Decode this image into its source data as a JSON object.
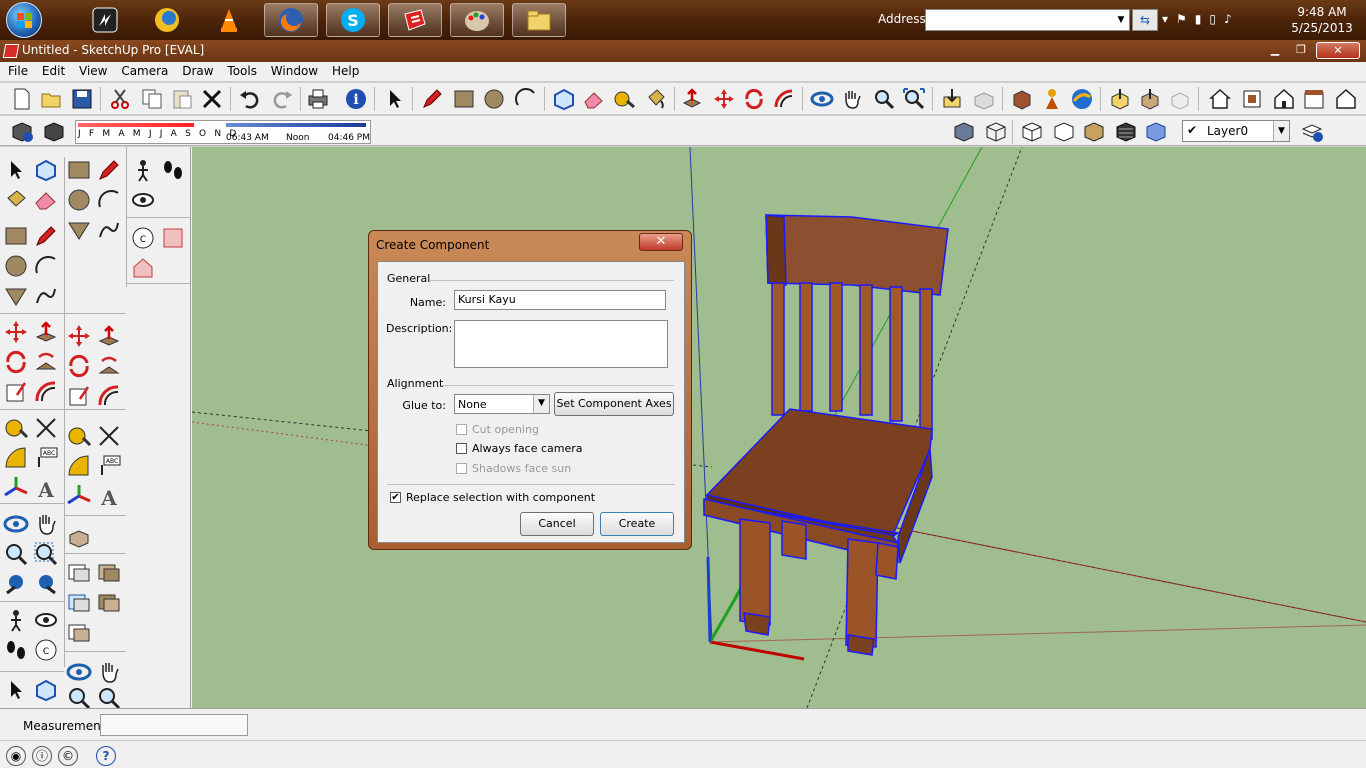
{
  "taskbar": {
    "address_label": "Address",
    "address_value": "",
    "clock_time": "9:48 AM",
    "clock_date": "5/25/2013"
  },
  "window": {
    "title": "Untitled - SketchUp Pro [EVAL]"
  },
  "menu": {
    "items": [
      "File",
      "Edit",
      "View",
      "Camera",
      "Draw",
      "Tools",
      "Window",
      "Help"
    ]
  },
  "shadow": {
    "months": "J F M A M J J A S O N D",
    "time_start": "06:43 AM",
    "time_mid": "Noon",
    "time_end": "04:46 PM"
  },
  "layers": {
    "current": "Layer0"
  },
  "status": {
    "measurements_label": "Measurements",
    "measurements_value": ""
  },
  "dialog": {
    "title": "Create Component",
    "close_glyph": "✕",
    "general_label": "General",
    "name_label": "Name:",
    "name_value": "Kursi Kayu",
    "description_label": "Description:",
    "description_value": "",
    "alignment_label": "Alignment",
    "glue_label": "Glue to:",
    "glue_value": "None",
    "set_axes_label": "Set Component Axes",
    "cut_opening_label": "Cut opening",
    "always_face_camera_label": "Always face camera",
    "shadows_face_sun_label": "Shadows face sun",
    "replace_selection_label": "Replace selection with component",
    "replace_selection_checked": true,
    "cancel_label": "Cancel",
    "create_label": "Create"
  },
  "colors": {
    "taskbar": "#4a2208",
    "titlebar": "#6a3412",
    "viewport_bg": "#9fbd8e",
    "chair_wood": "#8a4a24",
    "selection_blue": "#1a1aff"
  }
}
